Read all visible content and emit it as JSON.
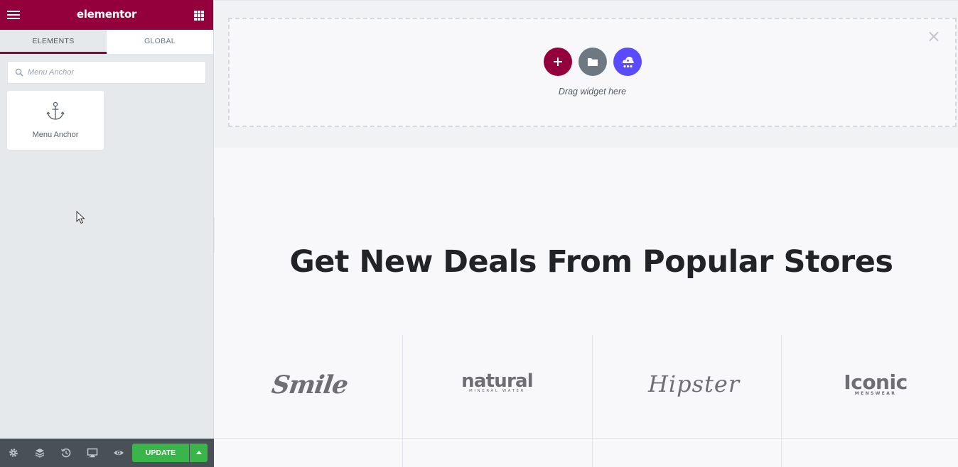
{
  "panel": {
    "logo": "elementor",
    "tabs": [
      {
        "label": "ELEMENTS",
        "active": true
      },
      {
        "label": "GLOBAL",
        "active": false
      }
    ],
    "search": {
      "placeholder": "Menu Anchor",
      "value": ""
    },
    "widgets": [
      {
        "label": "Menu Anchor",
        "icon": "anchor-icon"
      }
    ],
    "footer": {
      "icons": [
        "gear-icon",
        "layers-icon",
        "history-icon",
        "desktop-icon",
        "eye-icon"
      ],
      "update_label": "UPDATE"
    }
  },
  "canvas": {
    "dropzone": {
      "hint": "Drag widget here",
      "buttons": [
        "add-section-icon",
        "template-folder-icon",
        "ai-icon"
      ],
      "close": "×"
    },
    "section_title": "Get New Deals From Popular Stores",
    "brands": [
      {
        "name": "Smile"
      },
      {
        "name": "natural",
        "tagline": "MINERAL WATER"
      },
      {
        "name": "Hipster"
      },
      {
        "name": "Iconic",
        "tagline": "MENSWEAR"
      }
    ]
  },
  "colors": {
    "brand": "#93003c",
    "update": "#39b54a",
    "ai": "#5b4bff",
    "folder": "#6d7882"
  }
}
